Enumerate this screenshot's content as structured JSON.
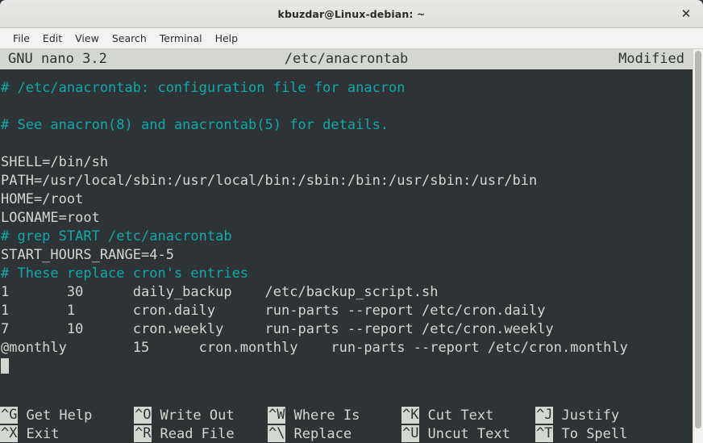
{
  "window": {
    "title": "kbuzdar@Linux-debian: ~",
    "close_label": "✕"
  },
  "menubar": {
    "items": [
      {
        "label": "File"
      },
      {
        "label": "Edit"
      },
      {
        "label": "View"
      },
      {
        "label": "Search"
      },
      {
        "label": "Terminal"
      },
      {
        "label": "Help"
      }
    ]
  },
  "nano": {
    "version": "GNU nano 3.2",
    "filename": "/etc/anacrontab",
    "status": "Modified",
    "lines": [
      {
        "text": "# /etc/anacrontab: configuration file for anacron",
        "type": "comment"
      },
      {
        "text": "",
        "type": "blank"
      },
      {
        "text": "# See anacron(8) and anacrontab(5) for details.",
        "type": "comment"
      },
      {
        "text": "",
        "type": "blank"
      },
      {
        "text": "SHELL=/bin/sh",
        "type": "text"
      },
      {
        "text": "PATH=/usr/local/sbin:/usr/local/bin:/sbin:/bin:/usr/sbin:/usr/bin",
        "type": "text"
      },
      {
        "text": "HOME=/root",
        "type": "text"
      },
      {
        "text": "LOGNAME=root",
        "type": "text"
      },
      {
        "text": "# grep START /etc/anacrontab",
        "type": "comment"
      },
      {
        "text": "START_HOURS_RANGE=4-5",
        "type": "text"
      },
      {
        "text": "# These replace cron's entries",
        "type": "comment"
      },
      {
        "text": "1\t30\tdaily_backup\t/etc/backup_script.sh",
        "type": "text"
      },
      {
        "text": "1\t1\tcron.daily\trun-parts --report /etc/cron.daily",
        "type": "text"
      },
      {
        "text": "7\t10\tcron.weekly\trun-parts --report /etc/cron.weekly",
        "type": "text"
      },
      {
        "text": "@monthly\t15\tcron.monthly\trun-parts --report /etc/cron.monthly",
        "type": "text"
      }
    ],
    "shortcuts_row1": [
      {
        "key": "^G",
        "label": "Get Help"
      },
      {
        "key": "^O",
        "label": "Write Out"
      },
      {
        "key": "^W",
        "label": "Where Is"
      },
      {
        "key": "^K",
        "label": "Cut Text"
      },
      {
        "key": "^J",
        "label": "Justify"
      }
    ],
    "shortcuts_row2": [
      {
        "key": "^X",
        "label": "Exit"
      },
      {
        "key": "^R",
        "label": "Read File"
      },
      {
        "key": "^\\",
        "label": "Replace"
      },
      {
        "key": "^U",
        "label": "Uncut Text"
      },
      {
        "key": "^T",
        "label": "To Spell"
      }
    ]
  },
  "colors": {
    "background": "#2e3436",
    "foreground": "#d3d7cf",
    "comment": "#11a8a8",
    "statusbar_bg": "#d3d7cf",
    "statusbar_fg": "#2e3436"
  }
}
